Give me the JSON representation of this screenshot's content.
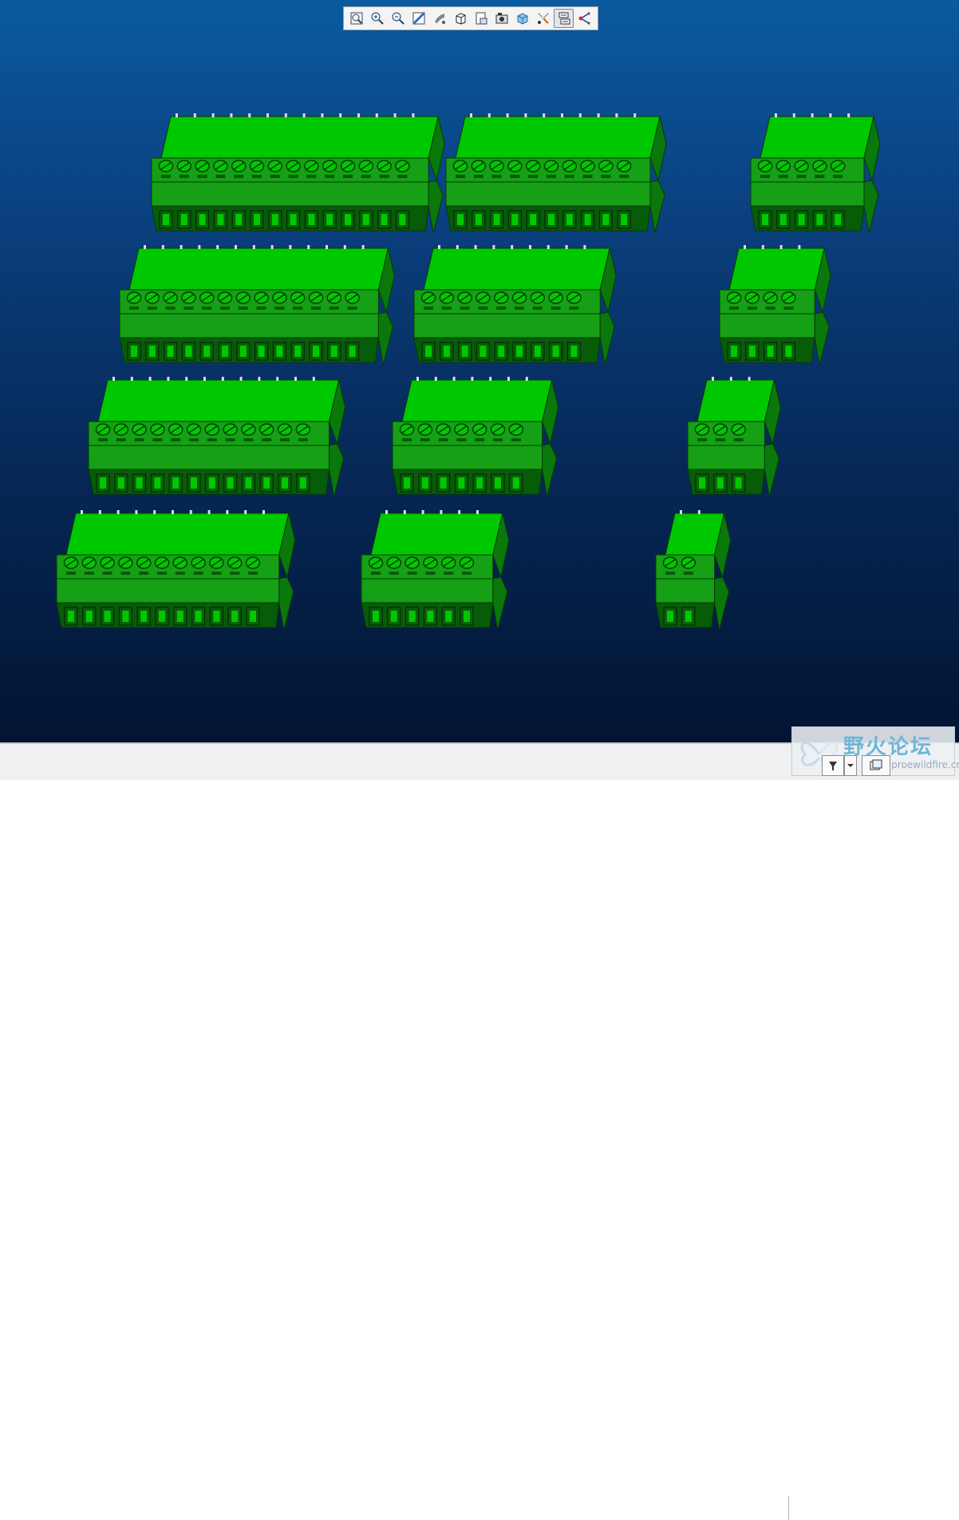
{
  "window": {
    "title": "",
    "background_gradient": [
      "#0a5aa0",
      "#021432"
    ]
  },
  "view_toolbar": {
    "buttons": [
      {
        "icon": "zoom-fit-icon",
        "tooltip": "Refit",
        "active": false
      },
      {
        "icon": "zoom-in-icon",
        "tooltip": "Zoom In",
        "active": false
      },
      {
        "icon": "zoom-out-icon",
        "tooltip": "Zoom Out",
        "active": false
      },
      {
        "icon": "repaint-icon",
        "tooltip": "Repaint",
        "active": false
      },
      {
        "icon": "display-style-icon",
        "tooltip": "Display Style",
        "active": false
      },
      {
        "icon": "saved-orientations-icon",
        "tooltip": "Saved Orientations",
        "active": false
      },
      {
        "icon": "view-manager-icon",
        "tooltip": "View Manager",
        "active": false
      },
      {
        "icon": "appearance-icon",
        "tooltip": "Appearance",
        "active": false
      },
      {
        "icon": "perspective-view-icon",
        "tooltip": "Perspective View",
        "active": false
      },
      {
        "icon": "datum-display-icon",
        "tooltip": "Datum Display Filters",
        "active": false
      },
      {
        "icon": "annotation-display-icon",
        "tooltip": "Annotation Display",
        "active": true
      },
      {
        "icon": "spin-center-icon",
        "tooltip": "Spin Center",
        "active": false
      }
    ]
  },
  "model": {
    "description": "Terminal block connector set",
    "body_colors": {
      "top": "#00c800",
      "front": "#15a015",
      "side": "#0a780a",
      "dark": "#075c07"
    },
    "connectors": [
      {
        "id": "c16",
        "pins": 14,
        "row": 1
      },
      {
        "id": "c10",
        "pins": 10,
        "row": 1
      },
      {
        "id": "c5",
        "pins": 5,
        "row": 1
      },
      {
        "id": "c14",
        "pins": 13,
        "row": 2
      },
      {
        "id": "c9",
        "pins": 9,
        "row": 2
      },
      {
        "id": "c4",
        "pins": 4,
        "row": 2
      },
      {
        "id": "c12",
        "pins": 12,
        "row": 3
      },
      {
        "id": "c7",
        "pins": 7,
        "row": 3
      },
      {
        "id": "c3",
        "pins": 3,
        "row": 3
      },
      {
        "id": "c11",
        "pins": 11,
        "row": 4
      },
      {
        "id": "c6",
        "pins": 6,
        "row": 4
      },
      {
        "id": "c2",
        "pins": 2,
        "row": 4
      }
    ]
  },
  "status_bar": {
    "buttons": [
      {
        "icon": "filter-icon"
      },
      {
        "icon": "dropdown-arrow-icon"
      },
      {
        "icon": "selection-box-icon"
      }
    ]
  },
  "watermark": {
    "title": "野火论坛",
    "url": "www.proewildfire.cn"
  }
}
